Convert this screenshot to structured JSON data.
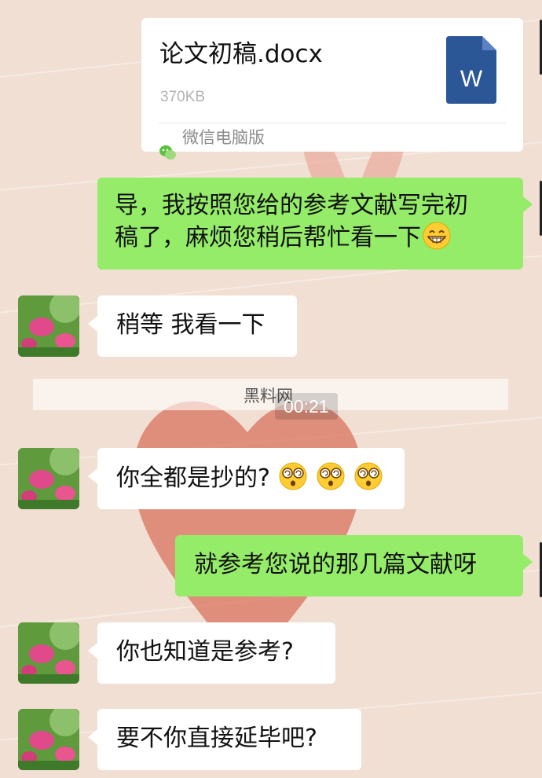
{
  "file_message": {
    "filename": "论文初稿.docx",
    "size": "370KB",
    "source": "微信电脑版",
    "icon_letter": "W",
    "icon_name": "word-doc-icon"
  },
  "messages": [
    {
      "from": "me",
      "text_line1": "导，我按照您给的参考文献写完初",
      "text_line2": "稿了，麻烦您稍后帮忙看一下",
      "emoji": "grin-emoji"
    },
    {
      "from": "them",
      "text": "稍等 我看一下"
    },
    {
      "from": "them",
      "text": "你全都是抄的?",
      "emojis": [
        "dizzy-face-emoji",
        "dizzy-face-emoji",
        "dizzy-face-emoji"
      ]
    },
    {
      "from": "me",
      "text": "就参考您说的那几篇文献呀"
    },
    {
      "from": "them",
      "text": "你也知道是参考?"
    },
    {
      "from": "them",
      "text": "要不你直接延毕吧?"
    }
  ],
  "timestamp": "00:21",
  "watermark": "黑料网",
  "colors": {
    "outgoing_bubble": "#95ec69",
    "incoming_bubble": "#ffffff",
    "background": "#f1dfd3",
    "word_blue": "#2b5797"
  }
}
